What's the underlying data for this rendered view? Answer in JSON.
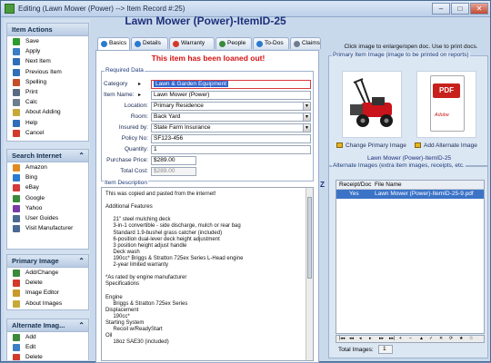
{
  "window": {
    "title": "Editing  (Lawn Mower (Power) --> Item Record #:25)",
    "min": "–",
    "max": "□",
    "close": "✕"
  },
  "sidebar": {
    "panels": [
      {
        "title": "Item Actions",
        "items": [
          {
            "label": "Save",
            "icon": "check-icon",
            "color": "#2e9a2e"
          },
          {
            "label": "Apply",
            "icon": "apply-icon",
            "color": "#3a7fc4"
          },
          {
            "label": "Next Item",
            "icon": "next-icon",
            "color": "#2f6fb8"
          },
          {
            "label": "Previous Item",
            "icon": "previous-icon",
            "color": "#2f6fb8"
          },
          {
            "label": "Spelling",
            "icon": "spelling-icon",
            "color": "#c24f2a"
          },
          {
            "label": "Print",
            "icon": "printer-icon",
            "color": "#5a6a80"
          },
          {
            "label": "Calc",
            "icon": "calculator-icon",
            "color": "#6e7d8f"
          },
          {
            "label": "About Adding",
            "icon": "info-icon",
            "color": "#c7a93a"
          },
          {
            "label": "Help",
            "icon": "help-icon",
            "color": "#2f6fb8"
          },
          {
            "label": "Cancel",
            "icon": "cancel-icon",
            "color": "#d23a2a"
          }
        ]
      },
      {
        "title": "Search Internet",
        "items": [
          {
            "label": "Amazon",
            "icon": "amazon-icon",
            "color": "#e08a22"
          },
          {
            "label": "Bing",
            "icon": "bing-icon",
            "color": "#2a7ad0"
          },
          {
            "label": "eBay",
            "icon": "ebay-icon",
            "color": "#d33a3a"
          },
          {
            "label": "Google",
            "icon": "google-icon",
            "color": "#3a8a3a"
          },
          {
            "label": "Yahoo",
            "icon": "yahoo-icon",
            "color": "#7a3aa8"
          },
          {
            "label": "User Guides",
            "icon": "guides-icon",
            "color": "#4a6a94"
          },
          {
            "label": "Visit Manufacturer",
            "icon": "manufacturer-icon",
            "color": "#4a6a94"
          }
        ]
      },
      {
        "title": "Primary Image",
        "items": [
          {
            "label": "Add/Change",
            "icon": "add-image-icon",
            "color": "#3a8a3a"
          },
          {
            "label": "Delete",
            "icon": "delete-icon",
            "color": "#d23a2a"
          },
          {
            "label": "Image Editor",
            "icon": "image-editor-icon",
            "color": "#c79a2a"
          },
          {
            "label": "About Images",
            "icon": "info-icon",
            "color": "#c7a93a"
          }
        ]
      },
      {
        "title": "Alternate Imag...",
        "items": [
          {
            "label": "Add",
            "icon": "add-icon",
            "color": "#3a8a3a"
          },
          {
            "label": "Edit",
            "icon": "edit-icon",
            "color": "#3a7fc4"
          },
          {
            "label": "Delete",
            "icon": "delete-icon",
            "color": "#d23a2a"
          }
        ]
      }
    ]
  },
  "record": {
    "title": "Lawn Mower (Power)-ItemID-25",
    "loaned_banner": "This item has been loaned out!",
    "tabs": [
      {
        "label": "Basics",
        "color": "#2a7ad0"
      },
      {
        "label": "Details",
        "color": "#2a7ad0"
      },
      {
        "label": "Warranty",
        "color": "#d23a2a"
      },
      {
        "label": "People",
        "color": "#3a8a3a"
      },
      {
        "label": "To-Dos",
        "color": "#2a7ad0"
      },
      {
        "label": "Claims",
        "color": "#6e7d8f"
      }
    ],
    "required_title": "Required Data",
    "fields": {
      "category": {
        "label": "Category",
        "value": "Lawn & Garden Equipment"
      },
      "item_name": {
        "label": "Item Name:",
        "value": "Lawn Mower (Power)"
      },
      "location": {
        "label": "Location:",
        "value": "Primary Residence"
      },
      "room": {
        "label": "Room:",
        "value": "Back Yard"
      },
      "insured_by": {
        "label": "Insured by:",
        "value": "State Farm Insurance"
      },
      "policy_no": {
        "label": "Policy No:",
        "value": "SF123-456"
      },
      "quantity": {
        "label": "Quantity:",
        "value": "1"
      },
      "purchase_price": {
        "label": "Purchase Price:",
        "value": "$289.00"
      },
      "total_cost": {
        "label": "Total Cost:",
        "value": "$289.00"
      }
    },
    "description_title": "Item Description",
    "description": "This was copied and pasted from the internet!\n\nAdditional Features\n\n     21\" steel mulching deck\n     3-in-1 convertible - side discharge, mulch or rear bag\n     Standard 1.9-bushel grass catcher (included)\n     6-position dual-lever deck height adjustment\n     3 position height adjust handle\n     Deck wash\n     190cc* Briggs & Stratton 725ex Series L-Head engine\n     2-year limited warranty\n\n*As rated by engine manufacturer\nSpecifications\n\nEngine\n     Briggs & Stratton 725ex Series\nDisplacement\n     190cc*\nStarting System\n     Recoil w/ReadyStart\nOil\n     18oz SAE30 (included)"
  },
  "right": {
    "hint": "Click image to enlarge/open doc. Use to print docs.",
    "primary_box_title": "Primary Item Image (image to be printed on reports)",
    "pdf_text": "PDF",
    "adobe_text": "Adobe",
    "change_primary": "Change Primary Image",
    "add_alternate": "Add Alternate Image",
    "caption": "Lawn Mower (Power)-ItemID-25",
    "alt_box_title": "Alternate Images (extra item images, receipts, etc.",
    "grid_headers": {
      "receipt": "Receipt/Doc",
      "file": "File Name"
    },
    "grid_rows": [
      {
        "receipt": "Yes",
        "file": "Lawn Mower (Power)-ItemID-25-9.pdf"
      }
    ],
    "nav_glyphs": [
      "|◂◂",
      "◂◂",
      "◂",
      "▸",
      "▸▸",
      "▸▸|",
      "+",
      "–",
      "▲",
      "✓",
      "✕",
      "⟳",
      "★",
      "☆"
    ],
    "total_label": "Total Images:",
    "total_value": "1"
  },
  "zoom_button": "Z"
}
